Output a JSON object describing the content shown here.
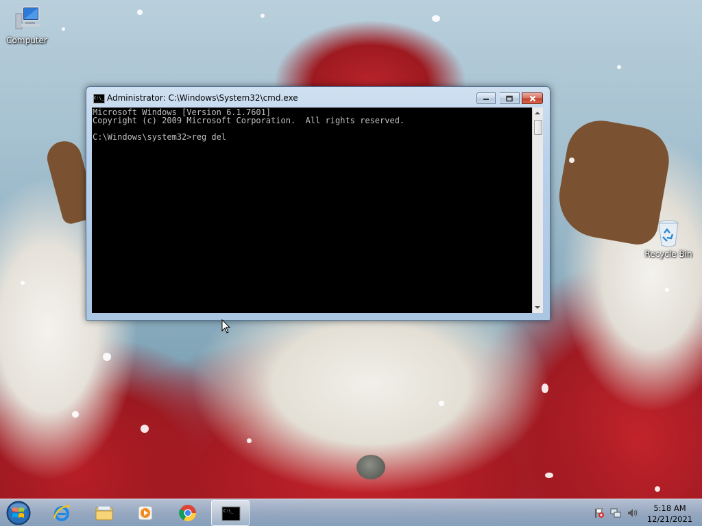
{
  "desktop": {
    "icons": [
      {
        "label": "Computer"
      },
      {
        "label": "Recycle Bin"
      }
    ]
  },
  "cmd_window": {
    "title": "Administrator: C:\\Windows\\System32\\cmd.exe",
    "icon_text": "C:\\_",
    "console_lines": [
      "Microsoft Windows [Version 6.1.7601]",
      "Copyright (c) 2009 Microsoft Corporation.  All rights reserved.",
      "",
      "C:\\Windows\\system32>reg del"
    ],
    "colors": {
      "background": "#000000",
      "text": "#c0c0c0"
    }
  },
  "taskbar": {
    "pinned": [
      {
        "name": "start-button"
      },
      {
        "name": "internet-explorer"
      },
      {
        "name": "windows-explorer"
      },
      {
        "name": "windows-media-player"
      },
      {
        "name": "google-chrome"
      },
      {
        "name": "command-prompt",
        "active": true,
        "icon_text": "C:\\_"
      }
    ],
    "tray": {
      "icons": [
        "action-center-flag-icon",
        "network-icon",
        "volume-icon"
      ],
      "time": "5:18 AM",
      "date": "12/21/2021"
    }
  }
}
